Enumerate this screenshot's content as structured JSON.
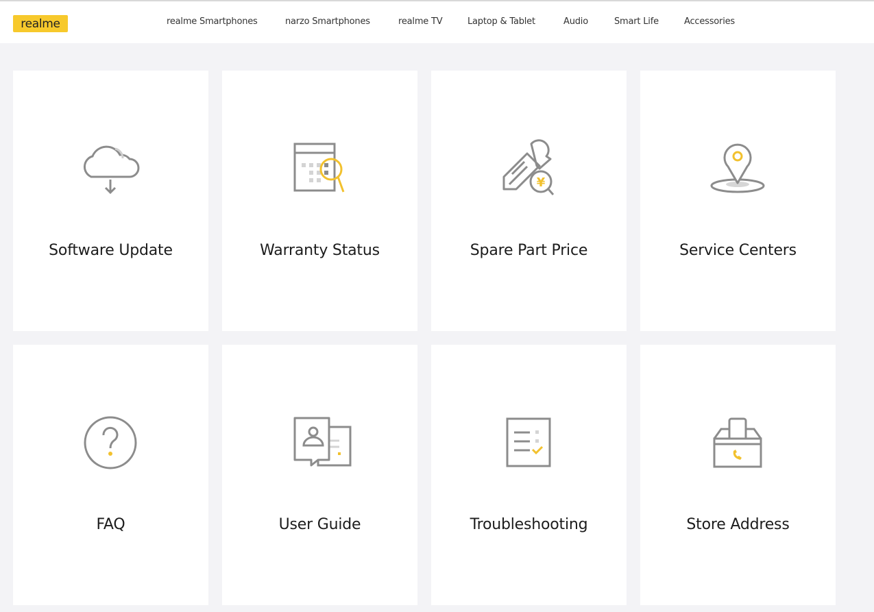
{
  "header": {
    "logo_text": "realme",
    "nav": [
      "realme Smartphones",
      "narzo Smartphones",
      "realme TV",
      "Laptop & Tablet",
      "Audio",
      "Smart Life",
      "Accessories"
    ]
  },
  "colors": {
    "brand_yellow": "#f7c92c",
    "icon_gray": "#8c8c8c",
    "icon_accent": "#f2c12e",
    "background": "#f3f3f6"
  },
  "cards": [
    {
      "label": "Software Update",
      "icon": "cloud-download-icon"
    },
    {
      "label": "Warranty Status",
      "icon": "warranty-search-icon"
    },
    {
      "label": "Spare Part Price",
      "icon": "screw-price-icon"
    },
    {
      "label": "Service Centers",
      "icon": "location-pin-icon"
    },
    {
      "label": "FAQ",
      "icon": "question-circle-icon"
    },
    {
      "label": "User Guide",
      "icon": "user-guide-icon"
    },
    {
      "label": "Troubleshooting",
      "icon": "checklist-icon"
    },
    {
      "label": "Store Address",
      "icon": "store-box-icon"
    }
  ]
}
